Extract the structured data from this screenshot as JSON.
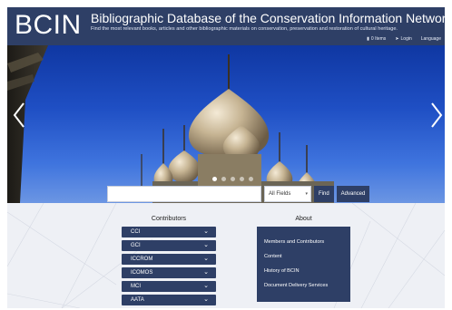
{
  "header": {
    "logo": "BCIN",
    "title": "Bibliographic Database of the Conservation Information Network",
    "subtitle": "Find the most relevant books, articles and other bibliographic materials on conservation, preservation and restoration of cultural heritage.",
    "links": {
      "items": "0 Items",
      "login": "Login",
      "language": "Language"
    }
  },
  "search": {
    "placeholder": "",
    "field_select": "All Fields",
    "find_label": "Find",
    "advanced_label": "Advanced"
  },
  "contributors": {
    "title": "Contributors",
    "items": [
      "CCI",
      "GCI",
      "ICCROM",
      "ICOMOS",
      "MCI",
      "AATA"
    ]
  },
  "about": {
    "title": "About",
    "links": [
      "Members and Contributors",
      "Content",
      "History of BCIN",
      "Document Delivery Services"
    ]
  },
  "colors": {
    "brand": "#2e3f66",
    "sky": "#1f4fc4"
  },
  "icons": {
    "cart": "cart-icon",
    "login": "login-icon",
    "carousel_prev": "chevron-left-icon",
    "carousel_next": "chevron-right-icon",
    "dropdown": "chevron-down-icon"
  }
}
